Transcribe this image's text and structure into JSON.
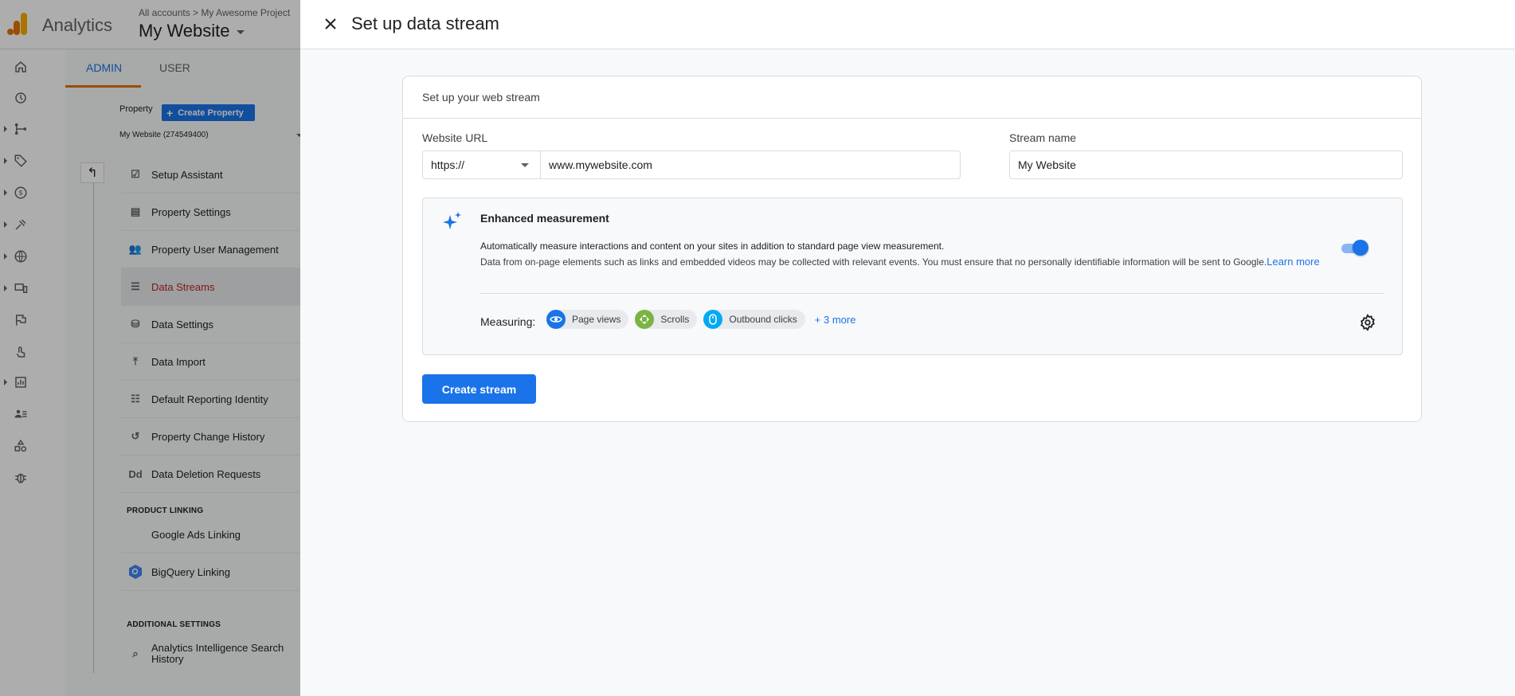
{
  "app": {
    "name": "Analytics",
    "breadcrumb": "All accounts > My Awesome Project",
    "property_title": "My Website"
  },
  "admin": {
    "tabs": [
      {
        "label": "ADMIN"
      },
      {
        "label": "USER"
      }
    ],
    "property_label": "Property",
    "create_property_label": "Create Property",
    "property_selected": "My Website (274549400)",
    "menu": [
      {
        "label": "Setup Assistant",
        "icon": "checkbox-icon"
      },
      {
        "label": "Property Settings",
        "icon": "layout-icon"
      },
      {
        "label": "Property User Management",
        "icon": "people-icon"
      },
      {
        "label": "Data Streams",
        "icon": "streams-icon"
      },
      {
        "label": "Data Settings",
        "icon": "database-icon"
      },
      {
        "label": "Data Import",
        "icon": "upload-icon"
      },
      {
        "label": "Default Reporting Identity",
        "icon": "identity-icon"
      },
      {
        "label": "Property Change History",
        "icon": "history-icon"
      },
      {
        "label": "Data Deletion Requests",
        "icon": "dd-icon"
      }
    ],
    "dd_glyph": "Dd",
    "product_linking_label": "PRODUCT LINKING",
    "product_linking": [
      {
        "label": "Google Ads Linking"
      },
      {
        "label": "BigQuery Linking"
      }
    ],
    "additional_settings_label": "ADDITIONAL SETTINGS",
    "additional_settings": [
      {
        "label": "Analytics Intelligence Search History"
      }
    ]
  },
  "drawer": {
    "title": "Set up data stream",
    "card_title": "Set up your web stream",
    "website_url_label": "Website URL",
    "protocol": "https://",
    "website_url": "www.mywebsite.com",
    "stream_name_label": "Stream name",
    "stream_name": "My Website",
    "enhanced": {
      "title": "Enhanced measurement",
      "desc1": "Automatically measure interactions and content on your sites in addition to standard page view measurement.",
      "desc2": "Data from on-page elements such as links and embedded videos may be collected with relevant events. You must ensure that no personally identifiable information will be sent to Google.",
      "learn_more": "Learn more",
      "enabled": true,
      "measuring_label": "Measuring:",
      "chips": [
        {
          "label": "Page views",
          "icon": "eye-icon",
          "color": "#1a73e8"
        },
        {
          "label": "Scrolls",
          "icon": "scroll-icon",
          "color": "#7cb342"
        },
        {
          "label": "Outbound clicks",
          "icon": "mouse-icon",
          "color": "#03a9f4"
        }
      ],
      "more": "+ 3 more"
    },
    "create_button": "Create stream"
  },
  "colors": {
    "primary": "#1a73e8",
    "active_menu": "#c5221f",
    "tab_underline": "#e37400"
  }
}
